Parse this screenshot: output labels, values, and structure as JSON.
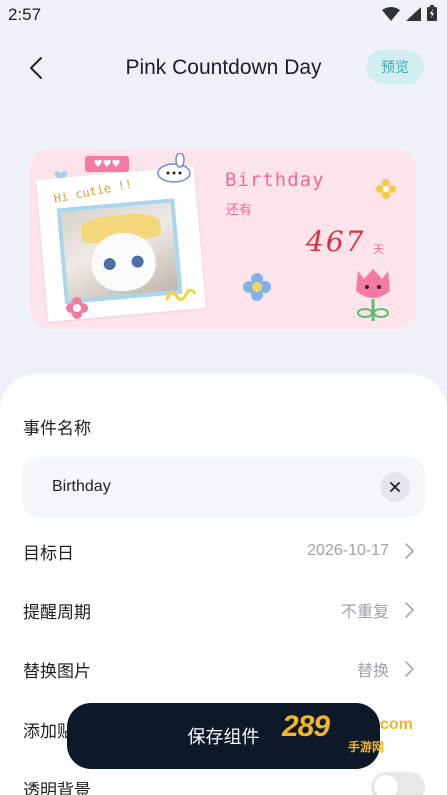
{
  "status_bar": {
    "time": "2:57"
  },
  "nav": {
    "title": "Pink Countdown Day",
    "preview_label": "预览"
  },
  "widget": {
    "greeting": "Hi cutie !!",
    "event_name": "Birthday",
    "remaining_label": "还有",
    "days": "467",
    "unit": "天"
  },
  "form": {
    "event_name_label": "事件名称",
    "event_name_value": "Birthday",
    "rows": [
      {
        "label": "目标日",
        "value": "2026-10-17"
      },
      {
        "label": "提醒周期",
        "value": "不重复"
      },
      {
        "label": "替换图片",
        "value": "替换"
      },
      {
        "label": "添加贴",
        "value": ""
      },
      {
        "label": "透明背景",
        "value": ""
      }
    ],
    "transparent_background": false
  },
  "save_label": "保存组件",
  "watermark": {
    "main": "289",
    "suffix": "com",
    "sub": "手游网"
  }
}
